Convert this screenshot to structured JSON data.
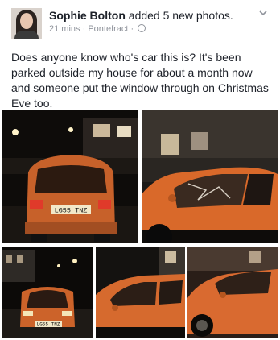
{
  "post": {
    "author": "Sophie Bolton",
    "action": "added 5 new photos.",
    "time": "21 mins",
    "separator1": "·",
    "location": "Pontefract",
    "separator2": "·",
    "text": "Does anyone know who's car this is? It's been parked outside my house for about a month now and someone put the window through on Christmas Eve too."
  },
  "photos": {
    "plate_rear": "LG55 TNZ",
    "plate_small": "LG55 TNZ"
  },
  "icons": [
    "avatar",
    "globe-icon",
    "chevron-down-icon"
  ],
  "colors": {
    "car_orange": "#d9692a",
    "meta_gray": "#90949c"
  }
}
